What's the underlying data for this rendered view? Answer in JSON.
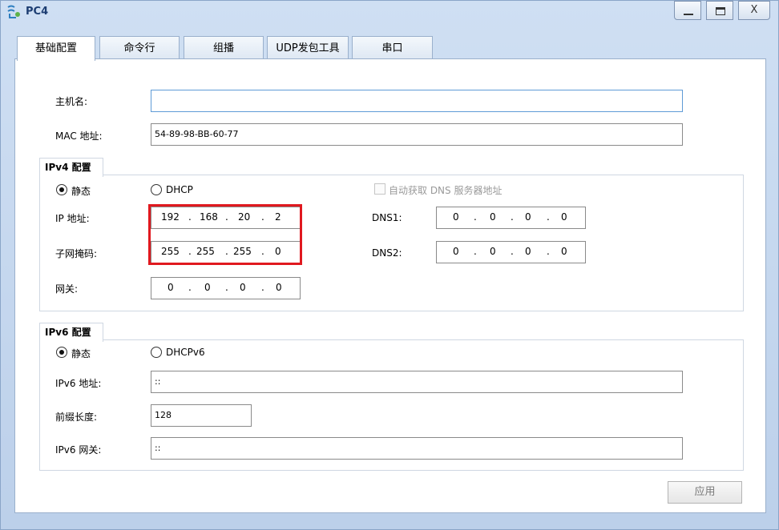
{
  "window": {
    "title": "PC4",
    "controls": {
      "minimize": "_",
      "close": "X"
    }
  },
  "tabs": [
    {
      "label": "基础配置",
      "active": true
    },
    {
      "label": "命令行",
      "active": false
    },
    {
      "label": "组播",
      "active": false
    },
    {
      "label": "UDP发包工具",
      "active": false
    },
    {
      "label": "串口",
      "active": false
    }
  ],
  "basic": {
    "hostname_label": "主机名:",
    "hostname_value": "",
    "mac_label": "MAC 地址:",
    "mac_value": "54-89-98-BB-60-77"
  },
  "ipv4": {
    "title": "IPv4 配置",
    "static_label": "静态",
    "dhcp_label": "DHCP",
    "mode": "static",
    "auto_dns_label": "自动获取 DNS 服务器地址",
    "auto_dns_checked": false,
    "ip_label": "IP 地址:",
    "ip": [
      "192",
      "168",
      "20",
      "2"
    ],
    "mask_label": "子网掩码:",
    "mask": [
      "255",
      "255",
      "255",
      "0"
    ],
    "gateway_label": "网关:",
    "gateway": [
      "0",
      "0",
      "0",
      "0"
    ],
    "dns1_label": "DNS1:",
    "dns1": [
      "0",
      "0",
      "0",
      "0"
    ],
    "dns2_label": "DNS2:",
    "dns2": [
      "0",
      "0",
      "0",
      "0"
    ],
    "separator": "."
  },
  "ipv6": {
    "title": "IPv6 配置",
    "static_label": "静态",
    "dhcp_label": "DHCPv6",
    "mode": "static",
    "addr_label": "IPv6 地址:",
    "addr_value": "::",
    "prefix_label": "前缀长度:",
    "prefix_value": "128",
    "gw_label": "IPv6 网关:",
    "gw_value": "::"
  },
  "apply_label": "应用",
  "colors": {
    "highlight": "#e0191f",
    "title": "#1c3d72",
    "focus_border": "#5f9bd6"
  }
}
